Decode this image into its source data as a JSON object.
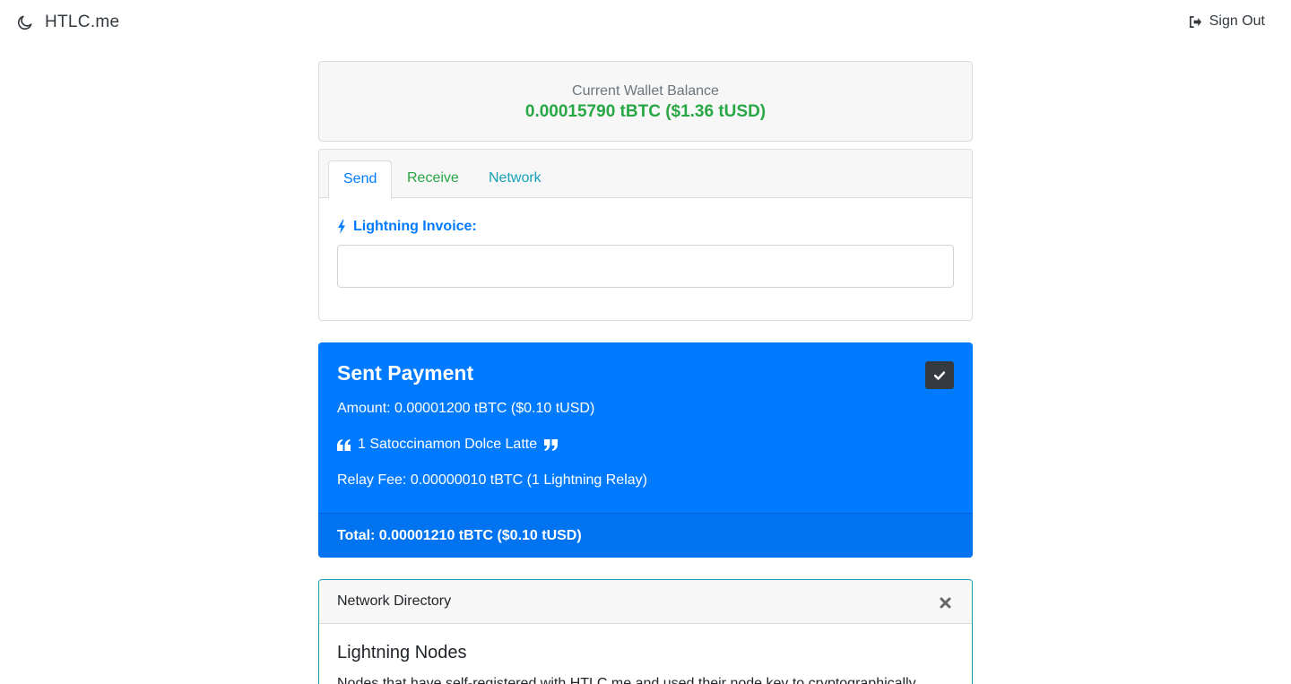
{
  "header": {
    "brand": "HTLC.me",
    "brand_icon": "moon-icon",
    "signout_label": "Sign Out",
    "signout_icon": "sign-out-icon"
  },
  "balance": {
    "label": "Current Wallet Balance",
    "value": "0.00015790 tBTC ($1.36 tUSD)",
    "color": "#28a745"
  },
  "tabs": {
    "items": [
      {
        "label": "Send",
        "active": true,
        "color": "#007bff"
      },
      {
        "label": "Receive",
        "active": false,
        "color": "#28a745"
      },
      {
        "label": "Network",
        "active": false,
        "color": "#17a2b8"
      }
    ]
  },
  "send": {
    "invoice_label": "Lightning Invoice:",
    "invoice_icon": "bolt-icon",
    "invoice_value": "",
    "invoice_placeholder": ""
  },
  "payment": {
    "title": "Sent Payment",
    "amount": "Amount: 0.00001200 tBTC ($0.10 tUSD)",
    "memo": "1 Satoccinamon Dolce Latte",
    "fee": "Relay Fee: 0.00000010 tBTC (1 Lightning Relay)",
    "total": "Total: 0.00001210 tBTC ($0.10 tUSD)",
    "color": "#007bff"
  },
  "network": {
    "title": "Network Directory",
    "nodes_title": "Lightning Nodes",
    "nodes_desc": "Nodes that have self-registered with HTLC.me and used their node key to cryptographically",
    "border_color": "#17a2b8"
  }
}
